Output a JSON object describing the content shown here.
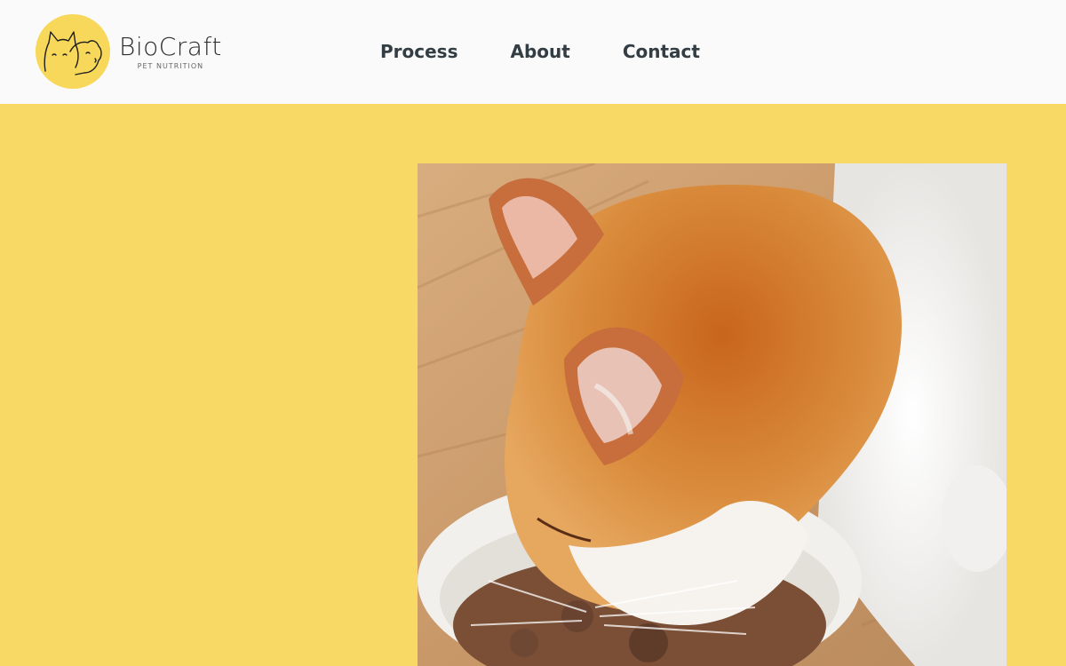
{
  "brand": {
    "name": "BioCraft",
    "tagline": "PET NUTRITION"
  },
  "nav": {
    "items": [
      {
        "label": "Process"
      },
      {
        "label": "About"
      },
      {
        "label": "Contact"
      }
    ]
  },
  "colors": {
    "accent_yellow": "#f9d965",
    "header_bg": "#fafafa",
    "nav_text": "#333d44"
  },
  "hero": {
    "image_icon": "cat-eating-photo"
  }
}
